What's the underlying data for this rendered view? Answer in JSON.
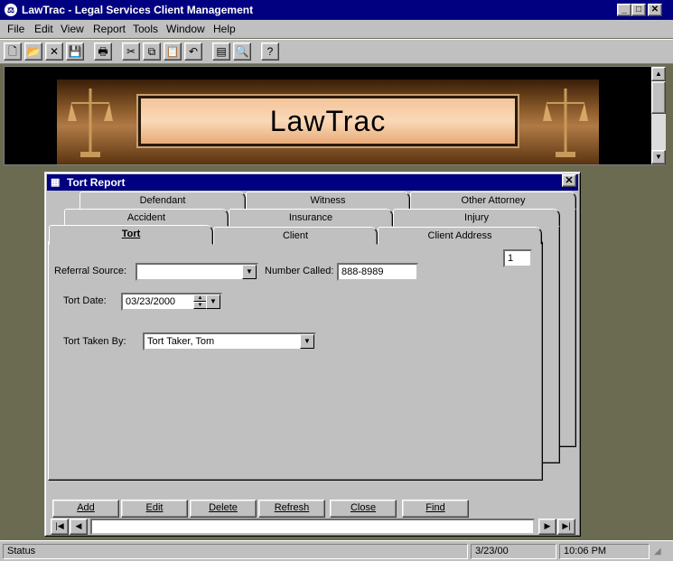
{
  "app": {
    "title": "LawTrac - Legal Services Client Management",
    "icon": "app-icon",
    "window_controls": [
      "minimize",
      "maximize",
      "close"
    ]
  },
  "menu": [
    "File",
    "Edit",
    "View",
    "Report",
    "Tools",
    "Window",
    "Help"
  ],
  "toolbar": {
    "buttons": [
      {
        "name": "new-icon",
        "glyph": "🗋"
      },
      {
        "name": "open-icon",
        "glyph": "📂"
      },
      {
        "name": "delete-icon",
        "glyph": "✕"
      },
      {
        "name": "save-icon",
        "glyph": "💾"
      },
      {
        "name": "print-icon",
        "glyph": "🖶"
      },
      {
        "name": "cut-icon",
        "glyph": "✂"
      },
      {
        "name": "copy-icon",
        "glyph": "⧉"
      },
      {
        "name": "paste-icon",
        "glyph": "📋"
      },
      {
        "name": "undo-icon",
        "glyph": "↶"
      },
      {
        "name": "properties-icon",
        "glyph": "▤"
      },
      {
        "name": "find-icon",
        "glyph": "🔍"
      },
      {
        "name": "help-icon",
        "glyph": "?"
      }
    ]
  },
  "banner": {
    "text": "LawTrac"
  },
  "child_window": {
    "title": "Tort Report",
    "tabs_row1": [
      "Defendant",
      "Witness",
      "Other Attorney"
    ],
    "tabs_row2": [
      "Accident",
      "Insurance",
      "Injury"
    ],
    "tabs_row3": [
      "Tort",
      "Client",
      "Client Address"
    ],
    "active_tab": "Tort",
    "record_number": "1",
    "form": {
      "referral_source_label": "Referral Source:",
      "referral_source_value": "",
      "number_called_label": "Number Called:",
      "number_called_value": "888-8989",
      "tort_date_label": "Tort Date:",
      "tort_date_value": "03/23/2000",
      "tort_taken_by_label": "Tort Taken By:",
      "tort_taken_by_value": "Tort Taker, Tom"
    },
    "buttons": [
      "Add",
      "Edit",
      "Delete",
      "Refresh",
      "Close",
      "Find"
    ]
  },
  "status": {
    "text": "Status",
    "date": "3/23/00",
    "time": "10:06 PM"
  }
}
